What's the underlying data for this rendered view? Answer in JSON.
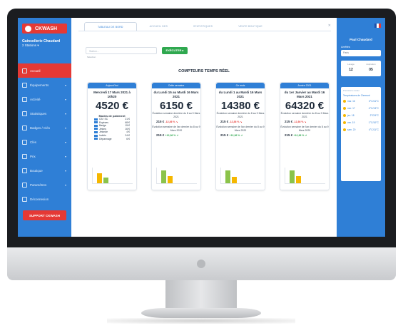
{
  "app": {
    "logo_text": "CKWASH"
  },
  "account": {
    "name": "Gainsollerie Chaudard",
    "sub": "2 Stations ▾"
  },
  "nav": [
    {
      "label": "Accueil",
      "icon": "home-icon",
      "active": true
    },
    {
      "label": "Équipements",
      "icon": "equipment-icon"
    },
    {
      "label": "Activité",
      "icon": "activity-icon"
    },
    {
      "label": "Statistiques",
      "icon": "stats-icon"
    },
    {
      "label": "Badges / Clés",
      "icon": "badge-icon"
    },
    {
      "label": "Clés",
      "icon": "key-icon"
    },
    {
      "label": "Prix",
      "icon": "price-icon"
    },
    {
      "label": "Boutique",
      "icon": "shop-icon"
    },
    {
      "label": "Paramètres",
      "icon": "settings-icon"
    },
    {
      "label": "Déconnexion",
      "icon": "logout-icon"
    }
  ],
  "support_label": "SUPPORT CKWASH",
  "tabs": [
    "TABLEAU DE BORD",
    "ACCUEIL DES",
    "STATISTIQUES",
    "VENTE BOUTIQUE"
  ],
  "filters": {
    "station_select": "Station…",
    "station_sub": "Sélection",
    "execute_label": "EXÉCUTER ▸"
  },
  "section_title": "COMPTEURS TEMPS RÉEL",
  "cards": [
    {
      "header": "Aujourd'hui",
      "date": "Mercredi 17 Mars 2021 à 10h20",
      "amount": "4520 €",
      "payments_title": "Modes de paiement",
      "payments": [
        {
          "label": "CB / SC",
          "value": "21 €"
        },
        {
          "label": "Espèces",
          "value": "68 €"
        },
        {
          "label": "Badge",
          "value": "15 €"
        },
        {
          "label": "Jetons",
          "value": "16 €"
        },
        {
          "label": "Jetonde",
          "value": "4 €"
        },
        {
          "label": "Invités",
          "value": "24 €"
        },
        {
          "label": "Dépannage",
          "value": "6 €"
        }
      ]
    },
    {
      "header": "Cette semaine",
      "date": "du Lundi 15 au Mardi 16 Mars 2021",
      "amount": "6150 €",
      "evo1": "Évolution semaine dernière du 8 au 9 Mars 2021",
      "stat1": "215 €",
      "pct1": "-12,36 % ↘",
      "evo2": "Évolution semaine de l'an dernier du 8 au 9 Mars 2020",
      "stat2": "215 €",
      "pct2": "+12,36 % ↗"
    },
    {
      "header": "Ce mois",
      "date": "du Lundi 1 au Mardi 16 Mars 2021",
      "amount": "14380 €",
      "evo1": "Évolution semaine dernière du 8 au 9 Mars 2021",
      "stat1": "215 €",
      "pct1": "-12,36 % ↘",
      "evo2": "Évolution semaine de l'an dernier du 8 au 9 Mars 2020",
      "stat2": "215 €",
      "pct2": "+12,36 % ↗"
    },
    {
      "header": "Année 2021",
      "date": "du 1er Janvier au Mardi 16 Mars 2021",
      "amount": "64320 €",
      "evo1": "Évolution semaine dernière du 8 au 9 Mars 2021",
      "stat1": "215 €",
      "pct1": "-12,36 % ↘",
      "evo2": "Évolution semaine de l'an dernier du 8 au 9 Mars 2020",
      "stat2": "215 €",
      "pct2": "+12,36 % ↗"
    }
  ],
  "right": {
    "user": "Paul Chaudard",
    "label": "Arrêtés",
    "select": "Paris",
    "col1_label": "Lavage",
    "col1_value": "12",
    "col2_label": "Aspiration",
    "col2_value": "05",
    "weather_title": "Prévisions météo",
    "weather_sub": "Températures de Clermont",
    "weather": [
      {
        "day": "mar. 16",
        "temp": "3°C/11°C"
      },
      {
        "day": "mer. 17",
        "temp": "4°C/13°C"
      },
      {
        "day": "jeu. 18",
        "temp": "2°C/9°C"
      },
      {
        "day": "ven. 19",
        "temp": "1°C/10°C"
      },
      {
        "day": "sam. 20",
        "temp": "4°C/11°C"
      }
    ]
  },
  "colors": {
    "sidebar": "#2f7fd6",
    "accent_red": "#e53935",
    "accent_green": "#2fa84f",
    "bar_yellow": "#f5b700",
    "bar_green": "#8bc34a"
  }
}
